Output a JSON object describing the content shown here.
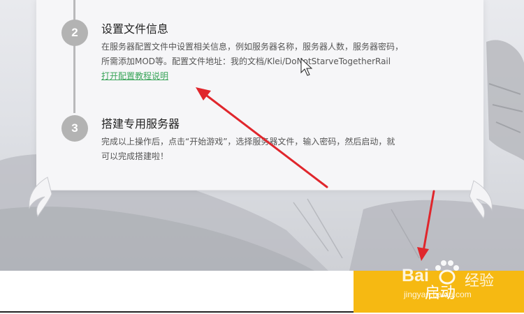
{
  "steps": [
    {
      "number": "2",
      "title": "设置文件信息",
      "desc_line1": "在服务器配置文件中设置相关信息，例如服务器名称，服务器人数，服务器密码，",
      "desc_line2": "所需添加MOD等。配置文件地址：我的文档/Klei/DoNotStarveTogetherRail",
      "link": "打开配置教程说明"
    },
    {
      "number": "3",
      "title": "搭建专用服务器",
      "desc_line1": "完成以上操作后，点击“开始游戏”，选择服务器文件，输入密码，然后启动，就",
      "desc_line2": "可以完成搭建啦！"
    }
  ],
  "start_button": {
    "label": "启动"
  },
  "watermark": {
    "brand": "Bai",
    "brand_cn": "经验",
    "url": "jingyan.baidu.com"
  },
  "colors": {
    "accent_button": "#f6b912",
    "link": "#3aa55a",
    "arrow": "#e0262c",
    "step_circle": "#b3b3b3"
  },
  "icons": [
    "mouse-cursor-icon",
    "annotation-arrow-icon",
    "paw-logo-icon",
    "horn-ornament-icon"
  ]
}
